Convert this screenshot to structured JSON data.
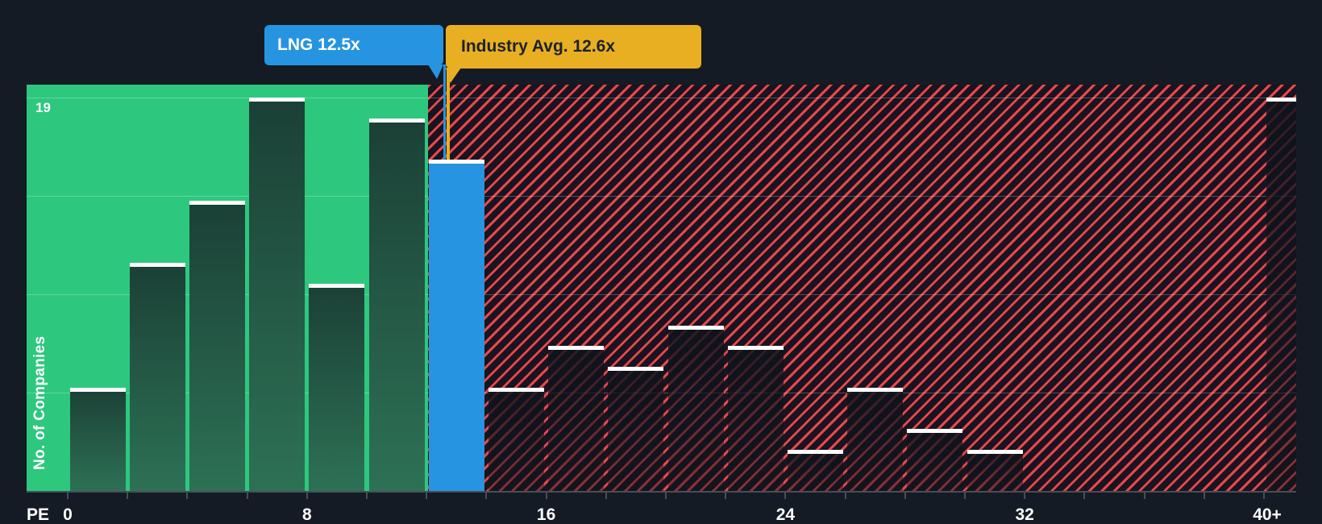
{
  "colors": {
    "background": "#151b24",
    "zone_green": "#2dc87d",
    "hatch_red": "#e8474c",
    "company_blue": "#2694e0",
    "industry_yellow": "#e9af22",
    "bar_cap_white": "#ffffff"
  },
  "company": {
    "name": "LNG",
    "label": "LNG 12.5x",
    "pe": 12.5
  },
  "industry": {
    "label": "Industry Avg. 12.6x",
    "pe": 12.6
  },
  "axis": {
    "x_prefix": "PE",
    "x_tick_labels": [
      "0",
      "8",
      "16",
      "24",
      "32",
      "40+"
    ],
    "x_tick_values": [
      0,
      8,
      16,
      24,
      32,
      40
    ],
    "y_label": "No. of Companies",
    "y_max_label": "19"
  },
  "chart_data": {
    "type": "bar",
    "title": "",
    "categories": [
      "0-2",
      "2-4",
      "4-6",
      "6-8",
      "8-10",
      "10-12",
      "12-14",
      "14-16",
      "16-18",
      "18-20",
      "20-22",
      "22-24",
      "24-26",
      "26-28",
      "28-30",
      "30-32",
      "32-34",
      "34-36",
      "36-38",
      "38-40",
      "40+"
    ],
    "values": [
      5,
      11,
      14,
      19,
      10,
      18,
      16,
      5,
      7,
      6,
      8,
      7,
      2,
      5,
      3,
      2,
      0,
      0,
      0,
      0,
      19
    ],
    "company_bucket_index": 6,
    "green_zone_pe_range": [
      0,
      12
    ],
    "hatch_zone_pe_range": [
      12,
      41
    ],
    "xlabel": "PE",
    "ylabel": "No. of Companies",
    "ylim": [
      0,
      19.6
    ],
    "xlim": [
      0,
      41
    ],
    "grid_values": [
      4.75,
      9.5,
      14.25,
      19
    ],
    "legend_position": "none",
    "markers": [
      {
        "label": "LNG 12.5x",
        "value": 12.5,
        "color": "#2694e0"
      },
      {
        "label": "Industry Avg. 12.6x",
        "value": 12.6,
        "color": "#e9af22"
      }
    ]
  }
}
